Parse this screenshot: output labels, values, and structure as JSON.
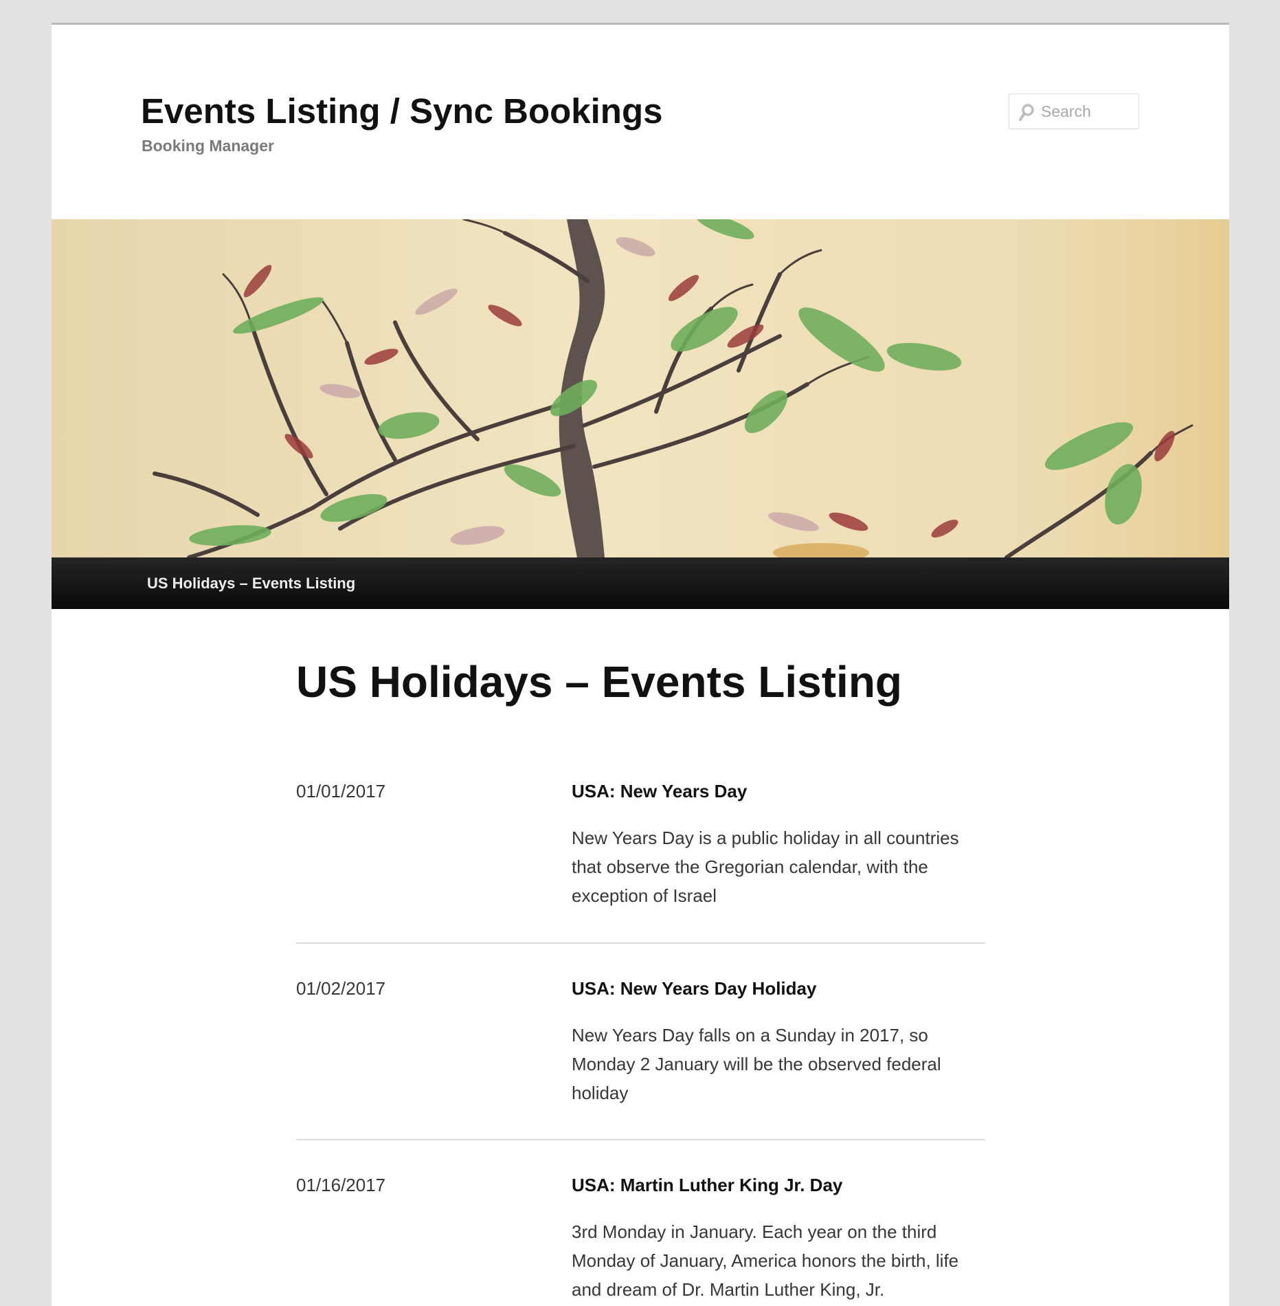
{
  "header": {
    "site_title": "Events Listing / Sync Bookings",
    "site_description": "Booking Manager",
    "search": {
      "placeholder": "Search",
      "icon": "search-icon"
    }
  },
  "banner": {
    "alt": "bonsai tree branches with red and green leaves"
  },
  "nav": {
    "items": [
      {
        "label": "US Holidays – Events Listing"
      }
    ]
  },
  "main": {
    "title": "US Holidays – Events Listing",
    "events": [
      {
        "date": "01/01/2017",
        "title": "USA: New Years Day",
        "description": "New Years Day is a public holiday in all countries that observe the Gregorian calendar, with the exception of Israel"
      },
      {
        "date": "01/02/2017",
        "title": "USA: New Years Day Holiday",
        "description": "New Years Day falls on a Sunday in 2017, so Monday 2 January will be the observed federal holiday"
      },
      {
        "date": "01/16/2017",
        "title": "USA: Martin Luther King Jr. Day",
        "description": "3rd Monday in January. Each year on the third Monday of January, America honors the birth, life and dream of Dr. Martin Luther King, Jr."
      }
    ]
  },
  "colors": {
    "page_background": "#e2e2e2",
    "content_background": "#ffffff",
    "nav_background": "#111111",
    "title_text": "#111111",
    "body_text": "#373737",
    "muted_text": "#7a7a7a"
  }
}
